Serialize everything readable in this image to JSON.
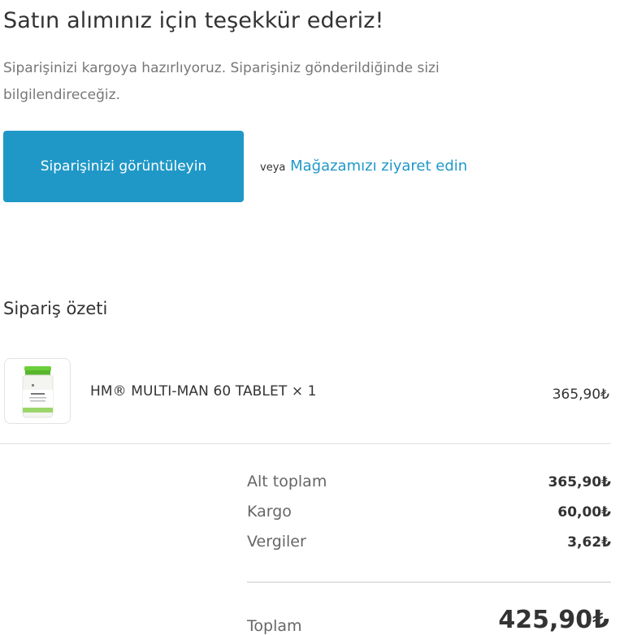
{
  "header": {
    "title": "Satın alımınız için teşekkür ederiz!",
    "message": "Siparişinizi kargoya hazırlıyoruz. Siparişiniz gönderildiğinde sizi bilgilendireceğiz."
  },
  "actions": {
    "view_order_label": "Siparişinizi görüntüleyin",
    "or_text": "veya",
    "visit_store_label": "Mağazamızı ziyaret edin"
  },
  "summary": {
    "heading": "Sipariş özeti",
    "item": {
      "name": "HM® MULTI-MAN 60 TABLET × 1",
      "price": "365,90₺",
      "thumbnail_icon": "supplement-bottle-icon"
    },
    "subtotal_label": "Alt toplam",
    "subtotal_value": "365,90₺",
    "shipping_label": "Kargo",
    "shipping_value": "60,00₺",
    "taxes_label": "Vergiler",
    "taxes_value": "3,62₺",
    "total_label": "Toplam",
    "total_value": "425,90₺"
  },
  "colors": {
    "accent": "#1f98c8",
    "text": "#333333",
    "muted_text": "#777777",
    "divider": "#e1e1e1",
    "bottle_cap": "#6ccf3a"
  }
}
